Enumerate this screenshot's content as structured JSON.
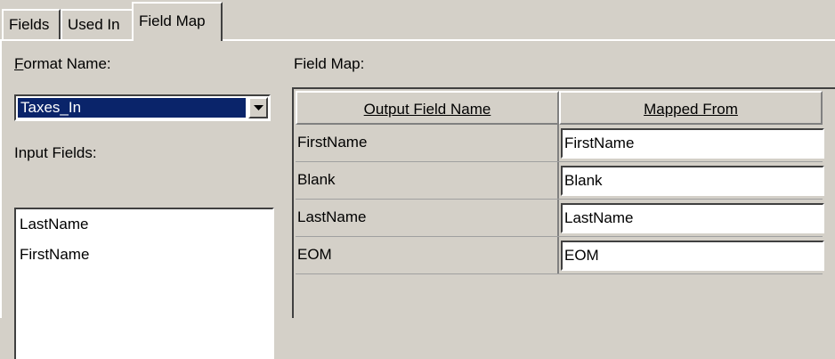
{
  "tabs": [
    {
      "label": "Fields"
    },
    {
      "label": "Used In"
    },
    {
      "label": "Field Map"
    }
  ],
  "active_tab": "Field Map",
  "format": {
    "label_accel": "F",
    "label_rest": "ormat Name:",
    "selected": "Taxes_In"
  },
  "input_fields": {
    "label": "Input Fields:",
    "items": [
      "LastName",
      "FirstName"
    ]
  },
  "field_map": {
    "label": "Field Map:",
    "headers": {
      "output": "Output Field Name",
      "mapped": "Mapped From"
    },
    "rows": [
      {
        "output": "FirstName",
        "mapped": "FirstName"
      },
      {
        "output": "Blank",
        "mapped": "Blank"
      },
      {
        "output": "LastName",
        "mapped": "LastName"
      },
      {
        "output": "EOM",
        "mapped": "EOM"
      }
    ]
  }
}
